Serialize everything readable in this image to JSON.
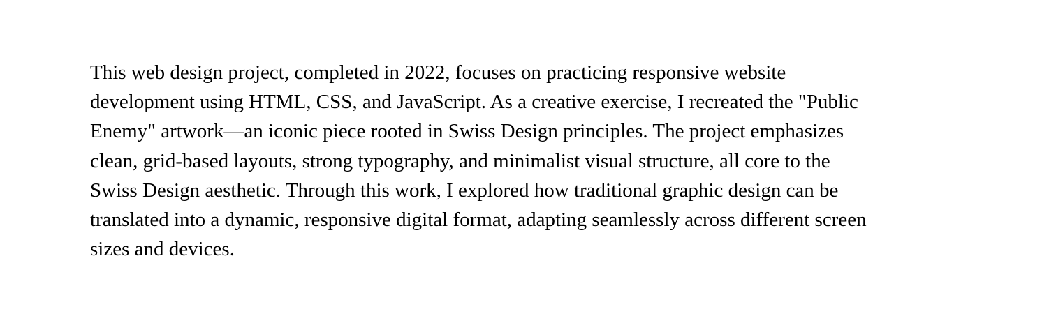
{
  "project_description": {
    "lines": [
      "This web design project, completed in 2022, focuses on practicing responsive website",
      "development using HTML, CSS, and JavaScript. As a creative exercise, I recreated the \"Public",
      "Enemy\" artwork—an iconic piece rooted in Swiss Design principles. The project emphasizes",
      "clean, grid-based layouts, strong typography, and minimalist visual structure, all core to the",
      "Swiss Design aesthetic. Through this work, I explored how traditional graphic design can be",
      "translated into a dynamic, responsive digital format, adapting seamlessly across different screen",
      "sizes and devices."
    ]
  }
}
